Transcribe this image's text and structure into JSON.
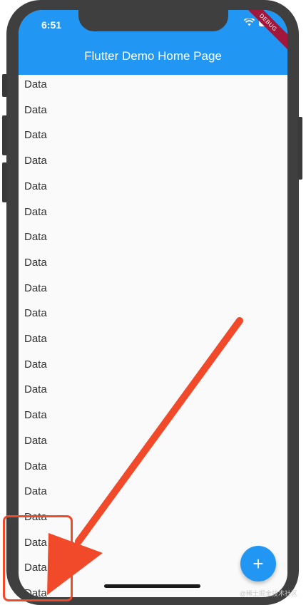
{
  "status_bar": {
    "time": "6:51",
    "icons": [
      "wifi-icon",
      "battery-icon"
    ]
  },
  "app_bar": {
    "title": "Flutter Demo Home Page",
    "color": "#2196f3"
  },
  "debug_banner": {
    "label": "DEBUG"
  },
  "list": {
    "items": [
      "Data",
      "Data",
      "Data",
      "Data",
      "Data",
      "Data",
      "Data",
      "Data",
      "Data",
      "Data",
      "Data",
      "Data",
      "Data",
      "Data",
      "Data",
      "Data",
      "Data",
      "Data",
      "Data",
      "Data",
      "Data"
    ]
  },
  "fab": {
    "icon": "plus-icon",
    "label": "+"
  },
  "annotation": {
    "highlight_color": "#f04a2a",
    "arrow": "arrow-icon"
  },
  "watermark": {
    "text": "@稀土掘金技术社区"
  }
}
